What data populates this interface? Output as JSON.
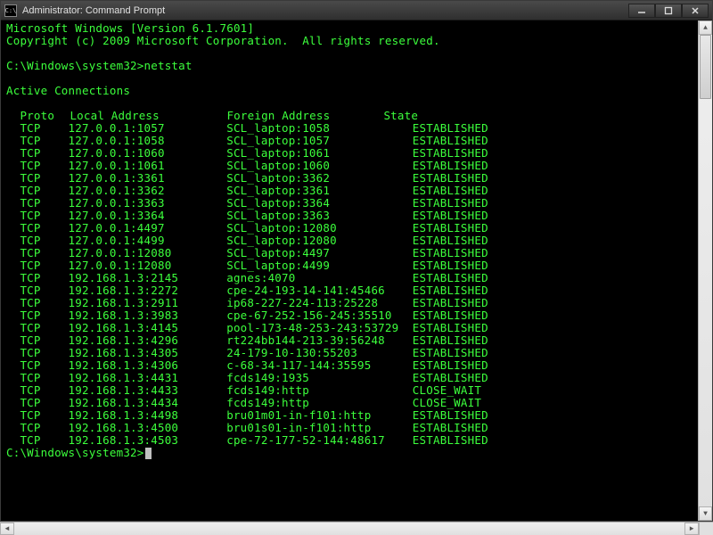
{
  "title": "Administrator: Command Prompt",
  "icon_label": "C:\\",
  "header_line1": "Microsoft Windows [Version 6.1.7601]",
  "header_line2": "Copyright (c) 2009 Microsoft Corporation.  All rights reserved.",
  "prompt_path": "C:\\Windows\\system32>",
  "command": "netstat",
  "section_title": "Active Connections",
  "columns": {
    "proto": "Proto",
    "local": "Local Address",
    "foreign": "Foreign Address",
    "state": "State"
  },
  "connections": [
    {
      "proto": "TCP",
      "local": "127.0.0.1:1057",
      "foreign": "SCL_laptop:1058",
      "state": "ESTABLISHED"
    },
    {
      "proto": "TCP",
      "local": "127.0.0.1:1058",
      "foreign": "SCL_laptop:1057",
      "state": "ESTABLISHED"
    },
    {
      "proto": "TCP",
      "local": "127.0.0.1:1060",
      "foreign": "SCL_laptop:1061",
      "state": "ESTABLISHED"
    },
    {
      "proto": "TCP",
      "local": "127.0.0.1:1061",
      "foreign": "SCL_laptop:1060",
      "state": "ESTABLISHED"
    },
    {
      "proto": "TCP",
      "local": "127.0.0.1:3361",
      "foreign": "SCL_laptop:3362",
      "state": "ESTABLISHED"
    },
    {
      "proto": "TCP",
      "local": "127.0.0.1:3362",
      "foreign": "SCL_laptop:3361",
      "state": "ESTABLISHED"
    },
    {
      "proto": "TCP",
      "local": "127.0.0.1:3363",
      "foreign": "SCL_laptop:3364",
      "state": "ESTABLISHED"
    },
    {
      "proto": "TCP",
      "local": "127.0.0.1:3364",
      "foreign": "SCL_laptop:3363",
      "state": "ESTABLISHED"
    },
    {
      "proto": "TCP",
      "local": "127.0.0.1:4497",
      "foreign": "SCL_laptop:12080",
      "state": "ESTABLISHED"
    },
    {
      "proto": "TCP",
      "local": "127.0.0.1:4499",
      "foreign": "SCL_laptop:12080",
      "state": "ESTABLISHED"
    },
    {
      "proto": "TCP",
      "local": "127.0.0.1:12080",
      "foreign": "SCL_laptop:4497",
      "state": "ESTABLISHED"
    },
    {
      "proto": "TCP",
      "local": "127.0.0.1:12080",
      "foreign": "SCL_laptop:4499",
      "state": "ESTABLISHED"
    },
    {
      "proto": "TCP",
      "local": "192.168.1.3:2145",
      "foreign": "agnes:4070",
      "state": "ESTABLISHED"
    },
    {
      "proto": "TCP",
      "local": "192.168.1.3:2272",
      "foreign": "cpe-24-193-14-141:45466",
      "state": "ESTABLISHED"
    },
    {
      "proto": "TCP",
      "local": "192.168.1.3:2911",
      "foreign": "ip68-227-224-113:25228",
      "state": "ESTABLISHED"
    },
    {
      "proto": "TCP",
      "local": "192.168.1.3:3983",
      "foreign": "cpe-67-252-156-245:35510",
      "state": "ESTABLISHED"
    },
    {
      "proto": "TCP",
      "local": "192.168.1.3:4145",
      "foreign": "pool-173-48-253-243:53729",
      "state": "ESTABLISHED"
    },
    {
      "proto": "TCP",
      "local": "192.168.1.3:4296",
      "foreign": "rt224bb144-213-39:56248",
      "state": "ESTABLISHED"
    },
    {
      "proto": "TCP",
      "local": "192.168.1.3:4305",
      "foreign": "24-179-10-130:55203",
      "state": "ESTABLISHED"
    },
    {
      "proto": "TCP",
      "local": "192.168.1.3:4306",
      "foreign": "c-68-34-117-144:35595",
      "state": "ESTABLISHED"
    },
    {
      "proto": "TCP",
      "local": "192.168.1.3:4431",
      "foreign": "fcds149:1935",
      "state": "ESTABLISHED"
    },
    {
      "proto": "TCP",
      "local": "192.168.1.3:4433",
      "foreign": "fcds149:http",
      "state": "CLOSE_WAIT"
    },
    {
      "proto": "TCP",
      "local": "192.168.1.3:4434",
      "foreign": "fcds149:http",
      "state": "CLOSE_WAIT"
    },
    {
      "proto": "TCP",
      "local": "192.168.1.3:4498",
      "foreign": "bru01m01-in-f101:http",
      "state": "ESTABLISHED"
    },
    {
      "proto": "TCP",
      "local": "192.168.1.3:4500",
      "foreign": "bru01s01-in-f101:http",
      "state": "ESTABLISHED"
    },
    {
      "proto": "TCP",
      "local": "192.168.1.3:4503",
      "foreign": "cpe-72-177-52-144:48617",
      "state": "ESTABLISHED"
    }
  ],
  "end_prompt": "C:\\Windows\\system32>"
}
